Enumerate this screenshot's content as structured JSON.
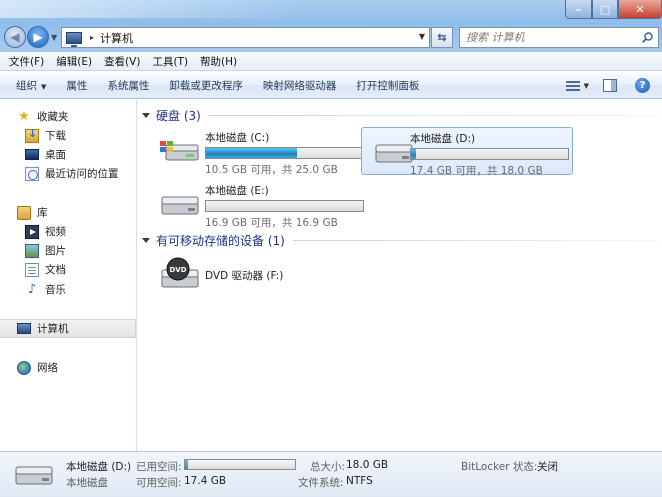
{
  "window": {
    "controls": {
      "minimize": "–",
      "maximize": "□",
      "close": "✕"
    }
  },
  "address": {
    "separator": "▸",
    "location": "计算机"
  },
  "search": {
    "placeholder": "搜索 计算机"
  },
  "menu": [
    "文件(F)",
    "编辑(E)",
    "查看(V)",
    "工具(T)",
    "帮助(H)"
  ],
  "commands": {
    "organize": "组织",
    "properties": "属性",
    "system_properties": "系统属性",
    "uninstall": "卸载或更改程序",
    "map_drive": "映射网络驱动器",
    "control_panel": "打开控制面板"
  },
  "nav": {
    "favorites": "收藏夹",
    "downloads": "下载",
    "desktop": "桌面",
    "recent": "最近访问的位置",
    "libraries": "库",
    "videos": "视频",
    "pictures": "图片",
    "documents": "文档",
    "music": "音乐",
    "computer": "计算机",
    "network": "网络"
  },
  "groups": {
    "hard_disks": "硬盘 (3)",
    "removable": "有可移动存储的设备 (1)"
  },
  "drives": [
    {
      "name": "本地磁盘 (C:)",
      "info": "10.5 GB 可用，共 25.0 GB",
      "used_fraction": 0.58
    },
    {
      "name": "本地磁盘 (D:)",
      "info": "17.4 GB 可用，共 18.0 GB",
      "used_fraction": 0.03
    },
    {
      "name": "本地磁盘 (E:)",
      "info": "16.9 GB 可用，共 16.9 GB",
      "used_fraction": 0.0
    }
  ],
  "dvd": {
    "name": "DVD 驱动器 (F:)",
    "badge": "DVD"
  },
  "details": {
    "title": "本地磁盘 (D:)",
    "subtitle": "本地磁盘",
    "used_label": "已用空间:",
    "used_fraction": 0.03,
    "free_label": "可用空间:",
    "free_value": "17.4 GB",
    "total_label": "总大小:",
    "total_value": "18.0 GB",
    "fs_label": "文件系统:",
    "fs_value": "NTFS",
    "bitlocker_label": "BitLocker 状态:",
    "bitlocker_value": "关闭"
  }
}
